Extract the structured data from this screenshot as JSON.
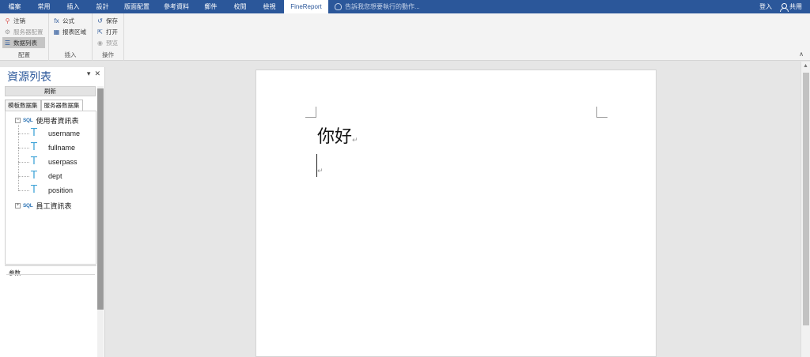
{
  "tabs": [
    {
      "label": "檔案",
      "active": false,
      "width": 37
    },
    {
      "label": "常用",
      "active": false,
      "width": 37
    },
    {
      "label": "插入",
      "active": false,
      "width": 37
    },
    {
      "label": "設計",
      "active": false,
      "width": 37
    },
    {
      "label": "版面配置",
      "active": false,
      "width": 50
    },
    {
      "label": "參考資料",
      "active": false,
      "width": 50
    },
    {
      "label": "郵件",
      "active": false,
      "width": 37
    },
    {
      "label": "校閱",
      "active": false,
      "width": 37
    },
    {
      "label": "檢視",
      "active": false,
      "width": 37
    },
    {
      "label": "FineReport",
      "active": true,
      "width": 56
    }
  ],
  "tellme": {
    "placeholder": "告訴我您想要執行的動作..."
  },
  "account": {
    "signin": "登入",
    "share": "共用"
  },
  "ribbon": {
    "groups": [
      {
        "label": "配置",
        "items": [
          {
            "label": "注销",
            "icon": "logout-icon",
            "icon_glyph": "⚲",
            "icon_color": "#d9534f",
            "state": "normal"
          },
          {
            "label": "服务器配置",
            "icon": "gear-icon",
            "icon_glyph": "⚙",
            "icon_color": "#999999",
            "state": "disabled"
          },
          {
            "label": "数据列表",
            "icon": "list-icon",
            "icon_glyph": "☰",
            "icon_color": "#2b579a",
            "state": "selected"
          }
        ]
      },
      {
        "label": "插入",
        "items": [
          {
            "label": "公式",
            "icon": "formula-icon",
            "icon_glyph": "fx",
            "icon_color": "#2b579a",
            "state": "normal"
          },
          {
            "label": "报表区域",
            "icon": "report-area-icon",
            "icon_glyph": "▦",
            "icon_color": "#2b579a",
            "state": "normal"
          }
        ]
      },
      {
        "label": "操作",
        "items": [
          {
            "label": "保存",
            "icon": "save-icon",
            "icon_glyph": "↺",
            "icon_color": "#2b579a",
            "state": "normal"
          },
          {
            "label": "打开",
            "icon": "open-icon",
            "icon_glyph": "⇱",
            "icon_color": "#2b579a",
            "state": "normal"
          },
          {
            "label": "预览",
            "icon": "preview-icon",
            "icon_glyph": "◉",
            "icon_color": "#aaaaaa",
            "state": "disabled"
          }
        ]
      }
    ]
  },
  "panel": {
    "title": "資源列表",
    "refresh_label": "刷新",
    "tabs": [
      {
        "label": "模板数据集",
        "active": false
      },
      {
        "label": "服务器数据集",
        "active": true
      }
    ],
    "tree": [
      {
        "label": "使用者資訊表",
        "type": "table",
        "expanded": true,
        "fields": [
          "username",
          "fullname",
          "userpass",
          "dept",
          "position"
        ]
      },
      {
        "label": "員工資訊表",
        "type": "table",
        "expanded": false,
        "fields": []
      }
    ],
    "params_label": "参数"
  },
  "document": {
    "text": "你好",
    "mark": "↵"
  },
  "colors": {
    "ribbon_blue": "#2b579a",
    "accent_text": "#41a5d8"
  }
}
